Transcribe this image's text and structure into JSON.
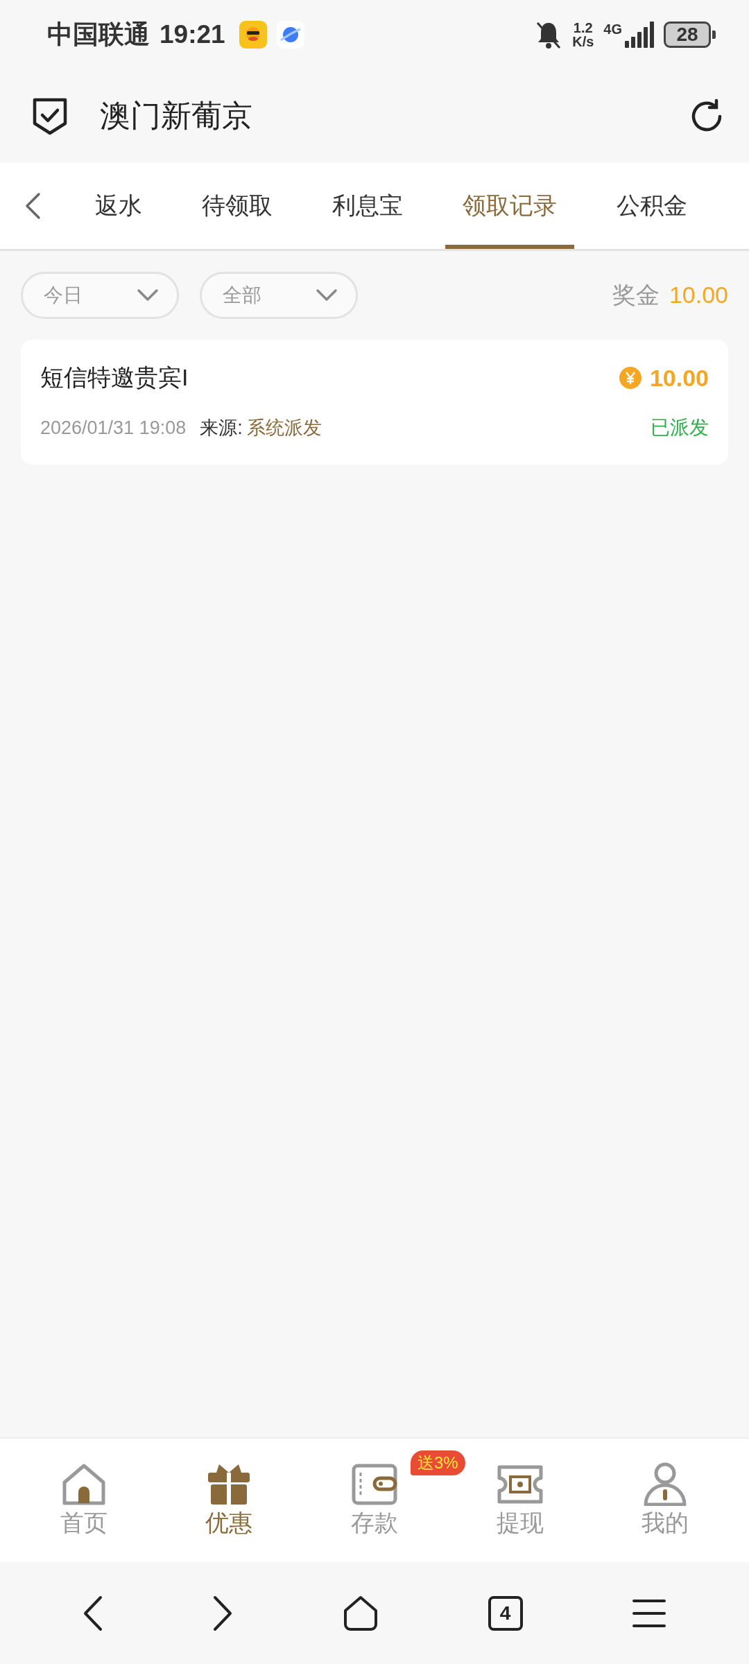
{
  "status_bar": {
    "carrier": "中国联通",
    "time": "19:21",
    "speed_value": "1.2",
    "speed_unit": "K/s",
    "network": "4G",
    "battery": "28"
  },
  "header": {
    "title": "澳门新葡京"
  },
  "tabs": [
    {
      "label": "返水",
      "selected": false
    },
    {
      "label": "待领取",
      "selected": false
    },
    {
      "label": "利息宝",
      "selected": false
    },
    {
      "label": "领取记录",
      "selected": true
    },
    {
      "label": "公积金",
      "selected": false
    }
  ],
  "filters": [
    {
      "value": "今日"
    },
    {
      "value": "全部"
    }
  ],
  "bonus": {
    "label": "奖金",
    "amount": "10.00"
  },
  "records": [
    {
      "title": "短信特邀贵宾I",
      "amount": "10.00",
      "time": "2026/01/31 19:08",
      "source_label": "来源:",
      "source": "系统派发",
      "status": "已派发"
    }
  ],
  "bottom_nav": [
    {
      "label": "首页",
      "kind": "home",
      "selected": false
    },
    {
      "label": "优惠",
      "kind": "gift",
      "selected": true
    },
    {
      "label": "存款",
      "kind": "wallet",
      "selected": false,
      "badge": "送3%"
    },
    {
      "label": "提现",
      "kind": "ticket",
      "selected": false
    },
    {
      "label": "我的",
      "kind": "user",
      "selected": false
    }
  ],
  "browser_nav": {
    "tab_count": "4"
  }
}
